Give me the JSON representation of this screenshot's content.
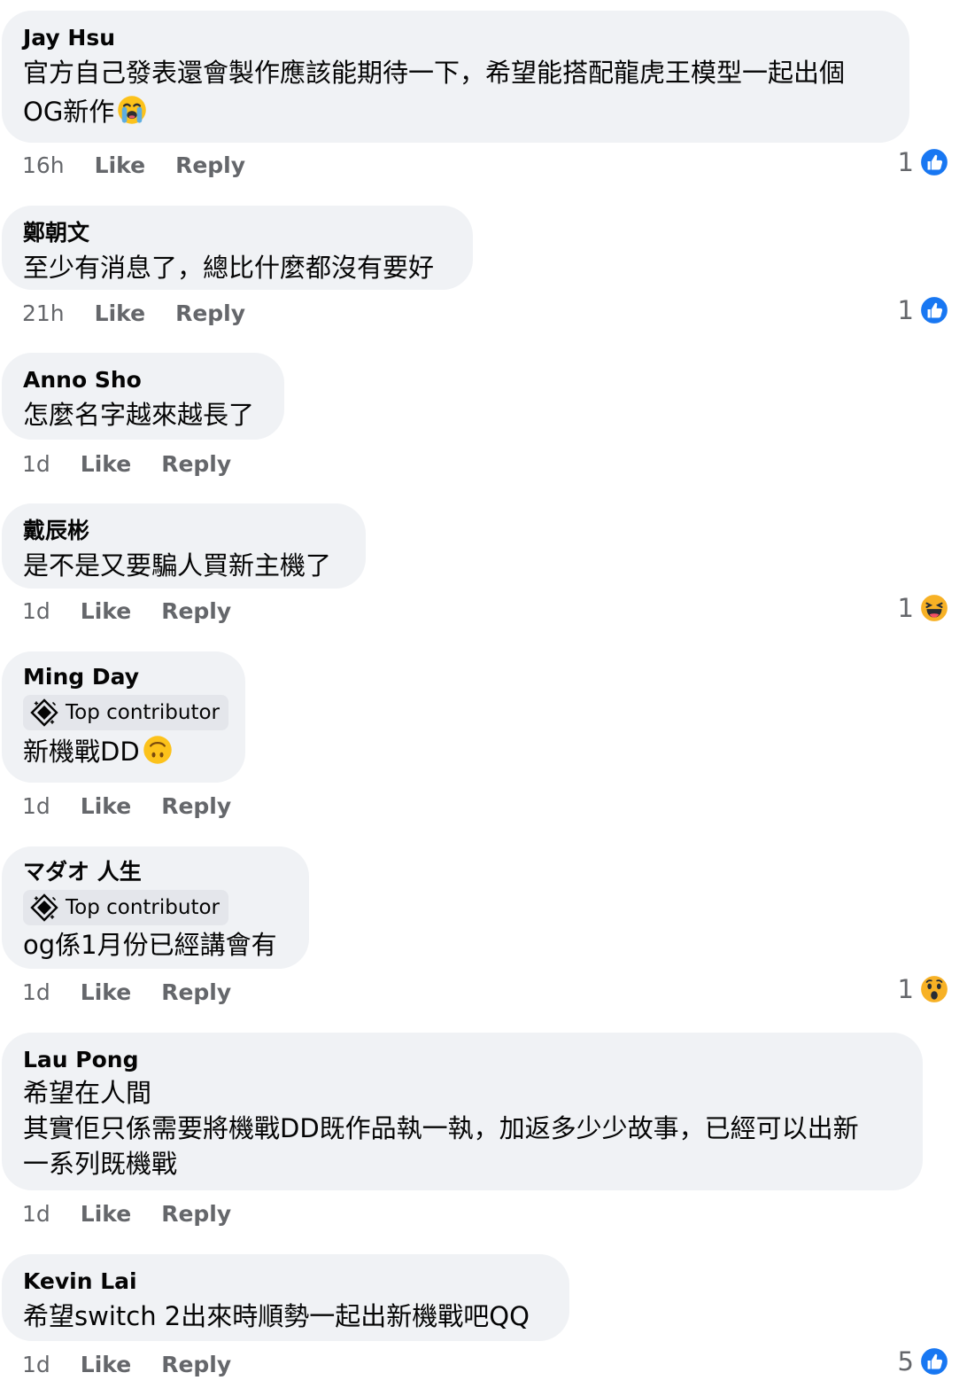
{
  "colors": {
    "bubble": "#f0f2f5",
    "badge": "#e4e6eb",
    "secondary_text": "#65676b",
    "like_blue": "#1877f2",
    "emoji_yellow": "#f7b125"
  },
  "comments": [
    {
      "author": "Jay Hsu",
      "body": "官方自己發表還會製作應該能期待一下，希望能搭配龍虎王模型一起出個\nOG新作",
      "body_emoji": "loudly-crying-face-emoji",
      "time": "16h",
      "like_label": "Like",
      "reply_label": "Reply",
      "reaction": {
        "count": "1",
        "icon": "like-reaction-icon"
      }
    },
    {
      "author": "鄭朝文",
      "body": "至少有消息了，總比什麼都沒有要好",
      "time": "21h",
      "like_label": "Like",
      "reply_label": "Reply",
      "reaction": {
        "count": "1",
        "icon": "like-reaction-icon"
      }
    },
    {
      "author": "Anno Sho",
      "body": "怎麼名字越來越長了",
      "time": "1d",
      "like_label": "Like",
      "reply_label": "Reply"
    },
    {
      "author": "戴辰彬",
      "body": "是不是又要騙人買新主機了",
      "time": "1d",
      "like_label": "Like",
      "reply_label": "Reply",
      "reaction": {
        "count": "1",
        "icon": "haha-reaction-icon"
      }
    },
    {
      "author": "Ming Day",
      "badge": "Top contributor",
      "body": "新機戰DD",
      "body_emoji": "upside-down-face-emoji",
      "time": "1d",
      "like_label": "Like",
      "reply_label": "Reply"
    },
    {
      "author": "マダオ 人生",
      "badge": "Top contributor",
      "body": "og係1月份已經講會有",
      "time": "1d",
      "like_label": "Like",
      "reply_label": "Reply",
      "reaction": {
        "count": "1",
        "icon": "wow-reaction-icon"
      }
    },
    {
      "author": "Lau Pong",
      "body": "希望在人間\n其實佢只係需要將機戰DD既作品執一執，加返多少少故事，已經可以出新\n一系列既機戰",
      "time": "1d",
      "like_label": "Like",
      "reply_label": "Reply"
    },
    {
      "author": "Kevin Lai",
      "body": "希望switch 2出來時順勢一起出新機戰吧QQ",
      "time": "1d",
      "like_label": "Like",
      "reply_label": "Reply",
      "reaction": {
        "count": "5",
        "icon": "like-reaction-icon"
      }
    }
  ]
}
